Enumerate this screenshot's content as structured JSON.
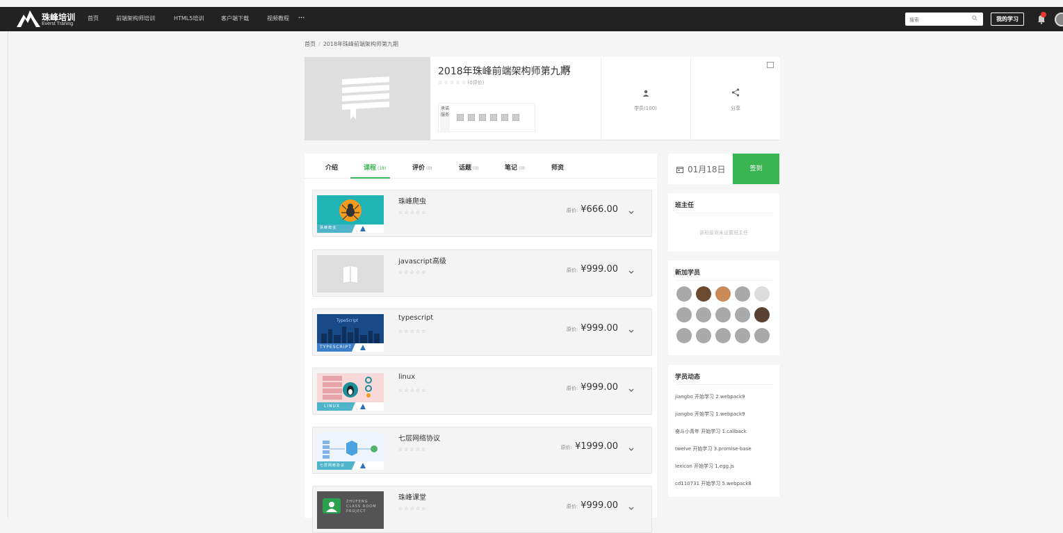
{
  "topbar": {
    "logo_cn": "珠峰培训",
    "logo_en": "Everst Traning",
    "nav": [
      "首页",
      "前端架构师培训",
      "HTML5培训",
      "客户端下载",
      "视频教程",
      "···"
    ],
    "search_placeholder": "搜索",
    "my_study": "我的学习"
  },
  "breadcrumb": {
    "home": "首页",
    "separator": "/",
    "current": "2018年珠峰前端架构师第九期"
  },
  "course": {
    "title": "2018年珠峰前端架构师第九期",
    "stars": "☆ ☆ ☆ ☆ ☆",
    "rating_count": "(0评价)",
    "promise_label": "承诺服务",
    "students": "学员(100)",
    "share": "分享"
  },
  "tabs": [
    {
      "label": "介绍",
      "count": ""
    },
    {
      "label": "课程",
      "count": "(18)"
    },
    {
      "label": "评价",
      "count": "(0)"
    },
    {
      "label": "话题",
      "count": "(0)"
    },
    {
      "label": "笔记",
      "count": "(0)"
    },
    {
      "label": "师资",
      "count": ""
    }
  ],
  "lessons": [
    {
      "name": "珠峰爬虫",
      "stars": "☆☆☆☆☆",
      "price_label": "原价:",
      "price": "¥666.00",
      "thumb": "spider"
    },
    {
      "name": "javascript高级",
      "stars": "☆☆☆☆☆",
      "price_label": "原价:",
      "price": "¥999.00",
      "thumb": "placeholder"
    },
    {
      "name": "typescript",
      "stars": "☆☆☆☆☆",
      "price_label": "原价:",
      "price": "¥999.00",
      "thumb": "typescript"
    },
    {
      "name": "linux",
      "stars": "☆☆☆☆☆",
      "price_label": "原价:",
      "price": "¥999.00",
      "thumb": "linux"
    },
    {
      "name": "七层网络协议",
      "stars": "☆☆☆☆☆",
      "price_label": "原价:",
      "price": "¥1999.00",
      "thumb": "network"
    },
    {
      "name": "珠峰课堂",
      "stars": "☆☆☆☆☆",
      "price_label": "原价:",
      "price": "¥999.00",
      "thumb": "classroom"
    }
  ],
  "thumb_text": {
    "spider": "珠峰爬虫",
    "typescript_top": "TypeScript",
    "typescript_bottom": "TYPESCRIPT",
    "linux": "LINUX",
    "network": "七层网络协议",
    "classroom": "ZHUFENG CLASS ROOM PROJECT"
  },
  "checkin": {
    "date": "01月18日",
    "button": "签到"
  },
  "head_teacher": {
    "title": "班主任",
    "empty": "该班级尚未设置班主任"
  },
  "new_members": {
    "title": "新加学员"
  },
  "activity": {
    "title": "学员动态",
    "items": [
      "jiangbo 开始学习 2.webpack9",
      "jiangbo 开始学习 1.webpack9",
      "奋斗小青年 开始学习 1.callback",
      "twelve 开始学习 3.promise-base",
      "lexicon 开始学习 1.egg.js",
      "cd110731 开始学习 5.webpack8"
    ]
  },
  "colors": {
    "accent": "#3bb552",
    "topbar": "#222222",
    "background": "#f5f5f5"
  }
}
